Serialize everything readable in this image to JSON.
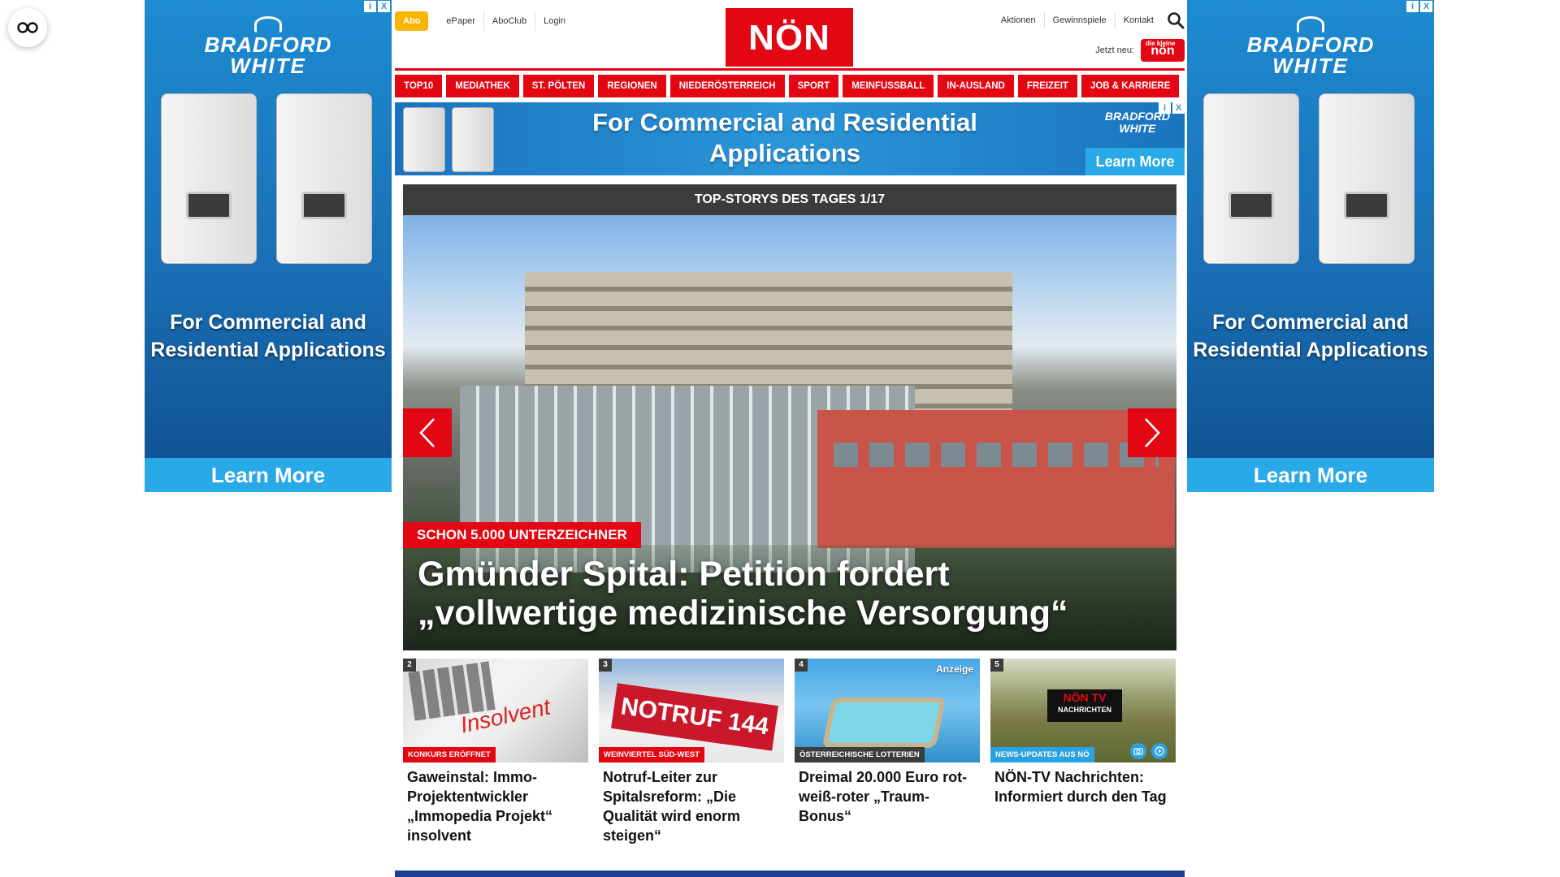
{
  "ads": {
    "brand_line1": "BRADFORD",
    "brand_line2": "WHITE",
    "side_text": "For Commercial and Residential Applications",
    "cta": "Learn More",
    "banner_text": "For Commercial and Residential Applications",
    "banner_cta": "Learn More",
    "adchoices": "i",
    "close": "X"
  },
  "header": {
    "abo": "Abo",
    "util_links": [
      "ePaper",
      "AboClub",
      "Login"
    ],
    "logo": "NÖN",
    "right_links": [
      "Aktionen",
      "Gewinnspiele",
      "Kontakt"
    ],
    "jetzt_label": "Jetzt neu:",
    "jetzt_logo": "nön",
    "jetzt_logo_sub": "die kleine"
  },
  "nav": [
    "TOP10",
    "MEDIATHEK",
    "ST. PÖLTEN",
    "REGIONEN",
    "NIEDERÖSTERREICH",
    "SPORT",
    "MEINFUSSBALL",
    "IN-AUSLAND",
    "FREIZEIT",
    "JOB & KARRIERE"
  ],
  "slider": {
    "heading": "TOP-STORYS DES TAGES 1/17",
    "kicker": "SCHON 5.000 UNTERZEICHNER",
    "title": "Gmünder Spital: Petition fordert „vollwertige medizinische Versorgung“"
  },
  "cards": [
    {
      "num": "2",
      "tag": "KONKURS ERÖFFNET",
      "title": "Gaweinstal: Immo-Projektentwickler „Immopedia Projekt“ insolvent",
      "stamp": "Insolvent"
    },
    {
      "num": "3",
      "tag": "WEINVIERTEL SÜD-WEST",
      "title": "Notruf-Leiter zur Spitalsreform: „Die Qualität wird enorm steigen“",
      "sign": "NOTRUF 144"
    },
    {
      "num": "4",
      "tag": "ÖSTERREICHISCHE LOTTERIEN",
      "title": "Dreimal 20.000 Euro rot-weiß-roter „Traum-Bonus“",
      "anzeige": "Anzeige"
    },
    {
      "num": "5",
      "tag": "NEWS-UPDATES AUS NÖ",
      "title": "NÖN-TV Nachrichten: Informiert durch den Tag",
      "tv_logo": "NÖN TV",
      "tv_sub": "NACHRICHTEN"
    }
  ],
  "colors": {
    "brand_red": "#e30613",
    "abo_yellow": "#f7b500",
    "dark_gray": "#3c3c3c",
    "accent_blue": "#2aa1e3"
  }
}
